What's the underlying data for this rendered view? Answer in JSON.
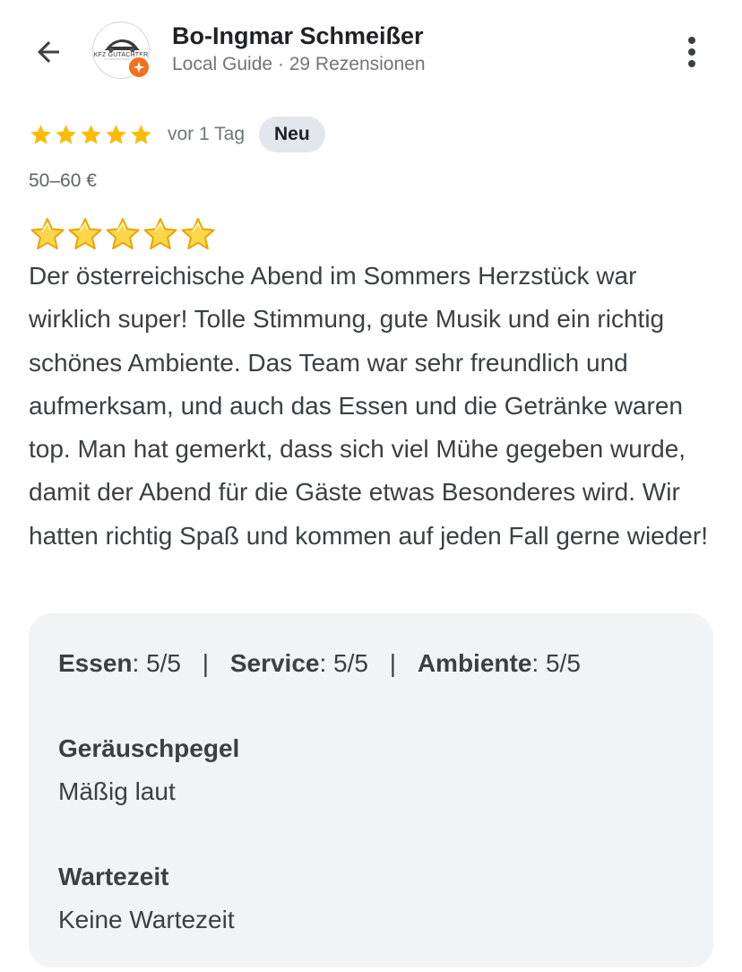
{
  "header": {
    "author_name": "Bo-Ingmar Schmeißer",
    "author_meta": "Local Guide · 29 Rezensionen",
    "avatar_text": "KFZ GUTACHTER",
    "icons": {
      "back": "back-arrow-icon",
      "more": "more-vertical-icon",
      "badge": "local-guide-star-icon"
    }
  },
  "review": {
    "rating": 5,
    "rating_max": 5,
    "time": "vor 1 Tag",
    "new_badge": "Neu",
    "price": "50–60 €",
    "emoji_stars": "⭐⭐⭐⭐⭐",
    "text": "Der österreichische Abend im Sommers Herzstück war wirklich super! Tolle Stimmung, gute Musik und ein richtig schönes Ambiente. Das Team war sehr freundlich und aufmerksam, und auch das Essen und die Getränke waren top. Man hat gemerkt, dass sich viel Mühe gegeben wurde, damit der Abend für die Gäste etwas Besonderes wird. Wir hatten richtig Spaß und kommen auf jeden Fall gerne wieder!"
  },
  "attributes": {
    "scores": [
      {
        "label": "Essen",
        "value": "5/5"
      },
      {
        "label": "Service",
        "value": "5/5"
      },
      {
        "label": "Ambiente",
        "value": "5/5"
      }
    ],
    "separator": "|",
    "noise_label": "Geräuschpegel",
    "noise_value": "Mäßig laut",
    "wait_label": "Wartezeit",
    "wait_value": "Keine Wartezeit"
  },
  "colors": {
    "star": "#fbbc04",
    "badge_orange": "#f2711c",
    "chip_bg": "#e3e6ea",
    "panel_bg": "#f1f3f4",
    "text": "#3c4043",
    "muted": "#70757a"
  }
}
